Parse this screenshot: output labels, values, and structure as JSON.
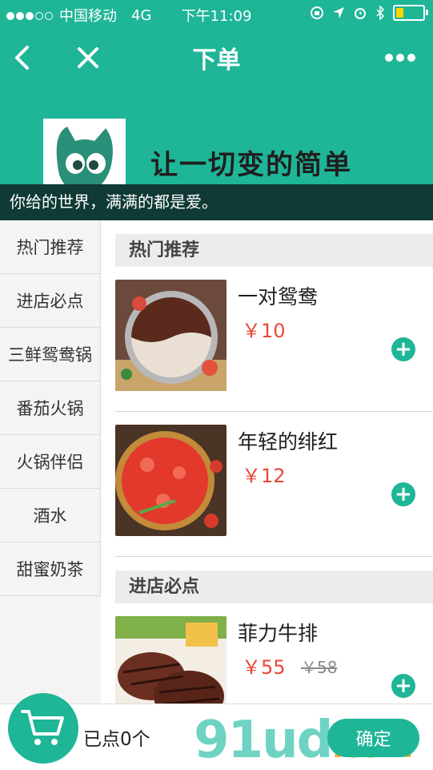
{
  "status_bar": {
    "carrier": "中国移动",
    "network": "4G",
    "time": "下午11:09",
    "battery_level": 0.3
  },
  "nav": {
    "title": "下单",
    "back_icon": "chevron-left-icon",
    "close_icon": "close-icon",
    "more_icon": "more-dots-icon"
  },
  "banner": {
    "slogan": "让一切变的简单",
    "subtitle": "你给的世界，满满的都是爱。"
  },
  "sidebar": {
    "items": [
      {
        "label": "热门推荐"
      },
      {
        "label": "进店必点"
      },
      {
        "label": "三鲜鸳鸯锅"
      },
      {
        "label": "番茄火锅"
      },
      {
        "label": "火锅伴侣"
      },
      {
        "label": "酒水"
      },
      {
        "label": "甜蜜奶茶"
      }
    ]
  },
  "menu": {
    "sections": [
      {
        "title": "热门推荐",
        "items": [
          {
            "name": "一对鸳鸯",
            "price": "￥10"
          },
          {
            "name": "年轻的绯红",
            "price": "￥12"
          }
        ]
      },
      {
        "title": "进店必点",
        "items": [
          {
            "name": "菲力牛排",
            "price": "￥55",
            "old_price": "￥58"
          }
        ]
      }
    ]
  },
  "bottom_bar": {
    "ordered_text": "已点0个",
    "confirm_label": "确定",
    "watermark": "91ud",
    "watermark_tail": ".com"
  },
  "colors": {
    "accent": "#1fb597",
    "price": "#e8483a",
    "subbar": "#0f3a35"
  }
}
